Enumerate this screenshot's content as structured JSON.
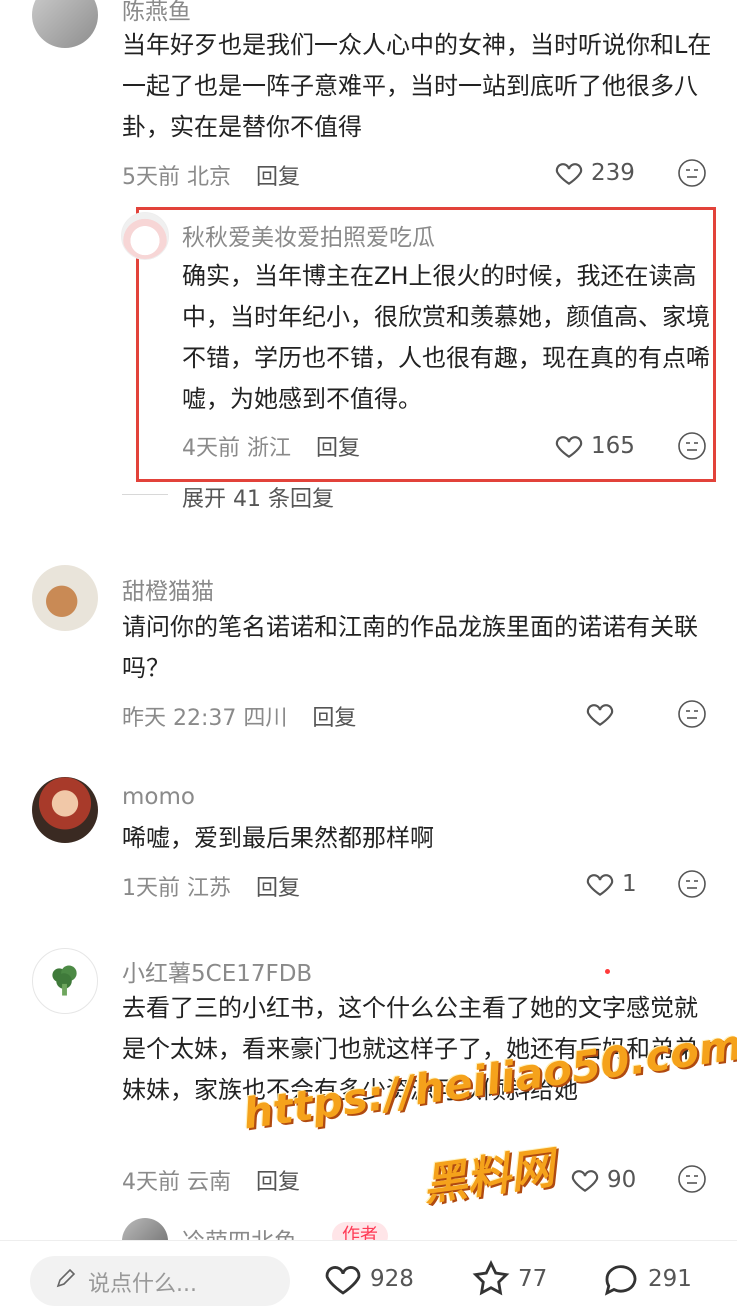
{
  "comments": [
    {
      "name": "陈燕鱼",
      "text": "当年好歹也是我们一众人心中的女神，当时听说你和L在一起了也是一阵子意难平，当时一站到底听了他很多八卦，实在是替你不值得",
      "time": "5天前",
      "location": "北京",
      "reply": "回复",
      "likes": "239"
    },
    {
      "name": "秋秋爱美妆爱拍照爱吃瓜",
      "text": "确实，当年博主在ZH上很火的时候，我还在读高中，当时年纪小，很欣赏和羡慕她，颜值高、家境不错，学历也不错，人也很有趣，现在真的有点唏嘘，为她感到不值得。",
      "time": "4天前",
      "location": "浙江",
      "reply": "回复",
      "likes": "165"
    },
    {
      "name": "甜橙猫猫",
      "text": "请问你的笔名诺诺和江南的作品龙族里面的诺诺有关联吗？",
      "time": "昨天 22:37",
      "location": "四川",
      "reply": "回复",
      "likes": ""
    },
    {
      "name": "momo",
      "text": "唏嘘，爱到最后果然都那样啊",
      "time": "1天前",
      "location": "江苏",
      "reply": "回复",
      "likes": "1"
    },
    {
      "name": "小红薯5CE17FDB",
      "text": "去看了三的小红书，这个什么公主看了她的文字感觉就是个太妹，看来豪门也就这样子了，她还有后妈和弟弟妹妹，家族也不会有多少资源可以倾斜给她",
      "time": "4天前",
      "location": "云南",
      "reply": "回复",
      "likes": "90"
    }
  ],
  "expand_replies": "展开 41 条回复",
  "next_comment": {
    "name": "冷萌四北鱼",
    "tag": "作者"
  },
  "bottom": {
    "input_placeholder": "说点什么...",
    "like_count": "928",
    "star_count": "77",
    "comment_count": "291"
  },
  "watermark": {
    "url": "https://heiliao50.com",
    "site": "黑料网"
  },
  "colors": {
    "highlight_border": "#e2423a",
    "meta_gray": "#8a8a8a",
    "watermark": "#f5a21b"
  }
}
